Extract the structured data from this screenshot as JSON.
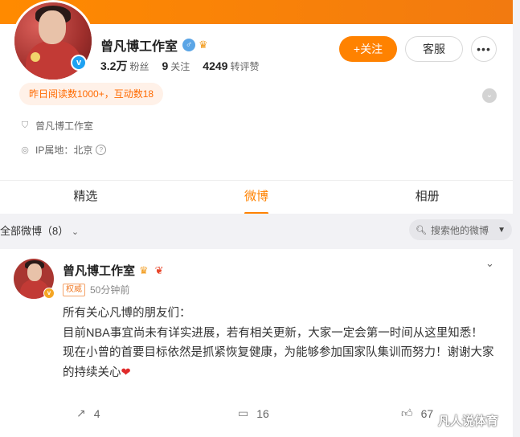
{
  "profile": {
    "name": "曾凡博工作室",
    "followers_value": "3.2万",
    "followers_label": "粉丝",
    "following_value": "9",
    "following_label": "关注",
    "engage_value": "4249",
    "engage_label": "转评赞",
    "follow_button": "+关注",
    "service_button": "客服",
    "more_button": "•••",
    "activity_badge": "昨日阅读数1000+，互动数18",
    "studio_info": "曾凡博工作室",
    "ip_location": "IP属地：北京",
    "qmark": "?"
  },
  "tabs": [
    {
      "label": "精选"
    },
    {
      "label": "微博"
    },
    {
      "label": "相册"
    }
  ],
  "filter": {
    "label": "全部微博（8）",
    "search_placeholder": "搜索他的微博"
  },
  "post": {
    "author": "曾凡博工作室",
    "tag": "权威",
    "time": "50分钟前",
    "lines": [
      "所有关心凡博的朋友们：",
      "目前NBA事宜尚未有详实进展，若有相关更新，大家一定会第一时间从这里知悉！",
      "现在小曾的首要目标依然是抓紧恢复健康，为能够参加国家队集训而努力！谢谢大家的持续关心"
    ],
    "reposts": "4",
    "comments": "16",
    "likes": "67"
  },
  "watermark": "凡人说体育",
  "colors": {
    "accent": "#ff8200",
    "verified": "#1da1f2"
  }
}
